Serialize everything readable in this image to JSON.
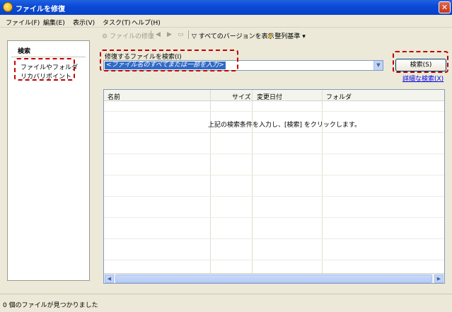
{
  "window": {
    "title": "ファイルを修復",
    "close_glyph": "✕"
  },
  "menu": [
    "ファイル(F)",
    "編集(E)",
    "表示(V)",
    "タスク(T)",
    "ヘルプ(H)"
  ],
  "toolbar": {
    "repair_label": "ファイルの修復",
    "back_glyph": "◀",
    "forward_glyph": "▶",
    "folder_glyph": "▭",
    "filter_label": "すべてのバージョンを表示",
    "sort_label": "整列基準"
  },
  "sidebar": {
    "title": "検索",
    "items": [
      {
        "label": "ファイルやフォルダ"
      },
      {
        "label": "リカバリポイント"
      }
    ]
  },
  "search": {
    "label": "修復するファイルを検索(I)",
    "value": "<ファイル名のすべてまたは一部を入力>",
    "button_label": "検索(S)",
    "advanced_link": "詳細な検索(X)",
    "dropdown_glyph": "▼"
  },
  "results": {
    "columns": [
      "名前",
      "サイズ",
      "変更日付",
      "フォルダ"
    ],
    "empty_message": "上記の検索条件を入力し、[検索] をクリックします。",
    "scroll_left": "◀",
    "scroll_right": "▶"
  },
  "status": {
    "text": "0 個のファイルが見つかりました"
  },
  "colors": {
    "titlebar": "#0a49d6",
    "annotation": "#c00000",
    "link": "#0000ee",
    "selection": "#316ac5"
  }
}
